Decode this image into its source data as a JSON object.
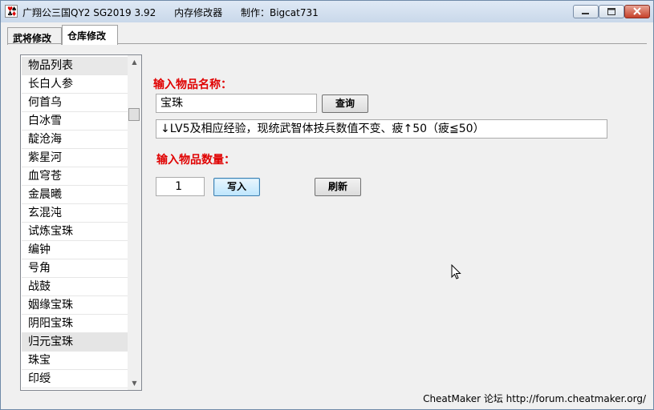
{
  "window": {
    "title": "广翔公三国QY2 SG2019 3.92      内存修改器      制作：Bigcat731",
    "minimize_symbol": "—",
    "maximize_symbol": "□",
    "close_symbol": "✕"
  },
  "tabs": [
    {
      "label": "武将修改",
      "active": false
    },
    {
      "label": "仓库修改",
      "active": true
    }
  ],
  "item_list": {
    "header": "物品列表",
    "items": [
      "长白人参",
      "何首乌",
      "白冰雪",
      "靛沧海",
      "紫星河",
      "血穹苍",
      "金晨曦",
      "玄混沌",
      "试炼宝珠",
      "编钟",
      "号角",
      "战鼓",
      "姻缘宝珠",
      "阴阳宝珠",
      "归元宝珠",
      "珠宝",
      "印绶"
    ],
    "hovered_index": 14
  },
  "form": {
    "name_label": "输入物品名称：",
    "name_value": "宝珠",
    "query_button": "查询",
    "description": "↓LV5及相应经验，现统武智体技兵数值不变、疲↑50（疲≦50）",
    "qty_label": "输入物品数量：",
    "qty_value": "1",
    "write_button": "写入",
    "refresh_button": "刷新"
  },
  "footer": {
    "text": "CheatMaker 论坛 http://forum.cheatmaker.org/"
  },
  "colors": {
    "label_red": "#e00000",
    "title_bar": "#c9d8ea",
    "close_button": "#c6412b"
  }
}
